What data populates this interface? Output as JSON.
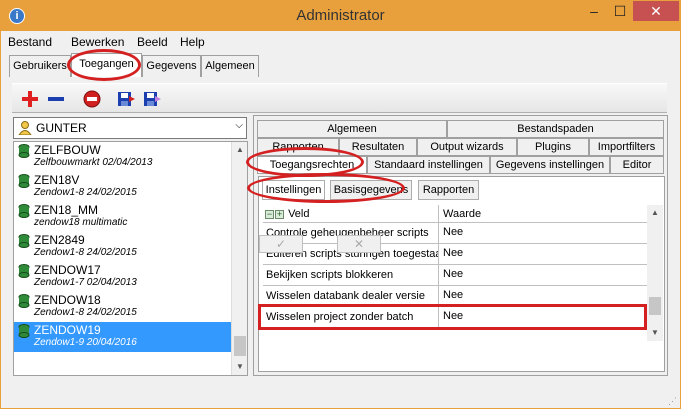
{
  "window": {
    "title": "Administrator",
    "minimize": "‒",
    "maximize": "☐",
    "close": "✕"
  },
  "menu": [
    "Bestand",
    "Bewerken",
    "Beeld",
    "Help"
  ],
  "top_tabs": [
    {
      "label": "Gebruikers",
      "active": false
    },
    {
      "label": "Toegangen",
      "active": true
    },
    {
      "label": "Gegevens",
      "active": false
    },
    {
      "label": "Algemeen",
      "active": false
    }
  ],
  "toolbar": [
    {
      "icon": "plus-icon",
      "color": "#e02020"
    },
    {
      "icon": "minus-icon",
      "color": "#1c3fb0"
    },
    {
      "icon": "no-entry-icon",
      "color": "#d02020"
    },
    {
      "icon": "save-in-icon",
      "color": "#1c3fb0"
    },
    {
      "icon": "save-out-icon",
      "color": "#1c3fb0"
    }
  ],
  "user_combo": {
    "value": "GUNTER",
    "arrow": "⌵"
  },
  "list": [
    {
      "name": "ZELFBOUW",
      "sub": "Zelfbouwmarkt 02/04/2013",
      "selected": false
    },
    {
      "name": "ZEN18V",
      "sub": "Zendow1-8 24/02/2015",
      "selected": false
    },
    {
      "name": "ZEN18_MM",
      "sub": "zendow18 multimatic",
      "selected": false
    },
    {
      "name": "ZEN2849",
      "sub": "Zendow1-8 24/02/2015",
      "selected": false
    },
    {
      "name": "ZENDOW17",
      "sub": "Zendow1-7 02/04/2013",
      "selected": false
    },
    {
      "name": "ZENDOW18",
      "sub": "Zendow1-8 24/02/2015",
      "selected": false
    },
    {
      "name": "ZENDOW19",
      "sub": "Zendow1-9 20/04/2016",
      "selected": true
    }
  ],
  "right_tabs": {
    "row1": [
      "Algemeen",
      "Bestandspaden"
    ],
    "row2": [
      "Rapporten",
      "Resultaten",
      "Output wizards",
      "Plugins",
      "Importfilters"
    ],
    "row3": [
      "Toegangsrechten",
      "Standaard instellingen",
      "Gegevens instellingen",
      "Editor"
    ]
  },
  "sub_tabs": [
    {
      "label": "Instellingen",
      "active": true
    },
    {
      "label": "Basisgegevens",
      "active": false
    },
    {
      "label": "Rapporten",
      "active": false
    }
  ],
  "grid": {
    "col_field": "Veld",
    "col_value": "Waarde",
    "expand_minus": "−",
    "expand_plus": "+",
    "rows": [
      {
        "field": "Controle geheugenbeheer scripts",
        "value": "Nee"
      },
      {
        "field": "Editeren scripts sturingen toegestaan",
        "value": "Nee"
      },
      {
        "field": "Bekijken scripts blokkeren",
        "value": "Nee"
      },
      {
        "field": "Wisselen databank dealer versie",
        "value": "Nee"
      },
      {
        "field": "Wisselen project zonder batch",
        "value": "Nee"
      }
    ]
  },
  "bottom_buttons": [
    "✓",
    "✕"
  ],
  "annotation_color": "#d42020"
}
